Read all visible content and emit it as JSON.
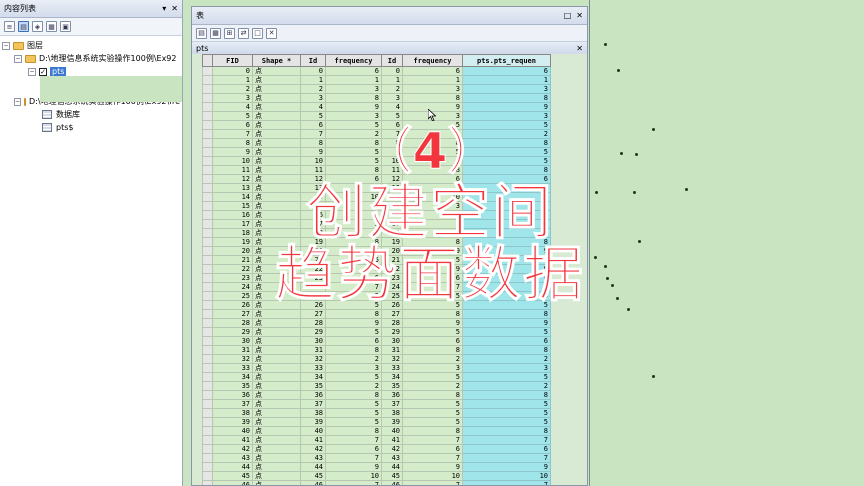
{
  "toc": {
    "title": "内容列表",
    "controls": [
      "▾",
      "✕"
    ],
    "tree": {
      "layers_root": "图层",
      "folder1": "D:\\地理信息系统实验操作100例\\Ex92",
      "layer_pts": "pts",
      "folder2": "D:\\地理信息系统实验操作100例\\Ex92\\fre",
      "table1": "数据库",
      "table2": "pts$"
    }
  },
  "table_window": {
    "title": "表",
    "controls": [
      "□",
      "✕"
    ],
    "tab_name": "pts",
    "tab_close": "✕",
    "columns": [
      "FID",
      "Shape *",
      "Id",
      "frequency",
      "Id",
      "frequency",
      "pts.pts_requen"
    ],
    "shape_value": "点",
    "rows": [
      [
        0,
        0,
        6,
        0,
        6,
        6
      ],
      [
        1,
        1,
        1,
        1,
        1,
        1
      ],
      [
        2,
        2,
        3,
        2,
        3,
        3
      ],
      [
        3,
        3,
        8,
        3,
        8,
        8
      ],
      [
        4,
        4,
        9,
        4,
        9,
        9
      ],
      [
        5,
        5,
        3,
        5,
        3,
        3
      ],
      [
        6,
        6,
        5,
        6,
        5,
        5
      ],
      [
        7,
        7,
        2,
        7,
        2,
        2
      ],
      [
        8,
        8,
        8,
        8,
        8,
        8
      ],
      [
        9,
        9,
        5,
        9,
        5,
        5
      ],
      [
        10,
        10,
        5,
        10,
        5,
        5
      ],
      [
        11,
        11,
        8,
        11,
        8,
        8
      ],
      [
        12,
        12,
        6,
        12,
        6,
        6
      ],
      [
        13,
        13,
        1,
        13,
        1,
        1
      ],
      [
        14,
        14,
        10,
        14,
        10,
        10
      ],
      [
        15,
        15,
        3,
        15,
        3,
        3
      ],
      [
        16,
        16,
        1,
        16,
        1,
        1
      ],
      [
        17,
        17,
        5,
        17,
        5,
        5
      ],
      [
        18,
        18,
        9,
        18,
        9,
        9
      ],
      [
        19,
        19,
        8,
        19,
        8,
        8
      ],
      [
        20,
        20,
        9,
        20,
        9,
        9
      ],
      [
        21,
        21,
        5,
        21,
        5,
        5
      ],
      [
        22,
        22,
        9,
        22,
        9,
        9
      ],
      [
        23,
        23,
        6,
        23,
        6,
        6
      ],
      [
        24,
        24,
        7,
        24,
        7,
        7
      ],
      [
        25,
        25,
        5,
        25,
        5,
        5
      ],
      [
        26,
        26,
        5,
        26,
        5,
        5
      ],
      [
        27,
        27,
        8,
        27,
        8,
        8
      ],
      [
        28,
        28,
        9,
        28,
        9,
        9
      ],
      [
        29,
        29,
        5,
        29,
        5,
        5
      ],
      [
        30,
        30,
        6,
        30,
        6,
        6
      ],
      [
        31,
        31,
        8,
        31,
        8,
        8
      ],
      [
        32,
        32,
        2,
        32,
        2,
        2
      ],
      [
        33,
        33,
        3,
        33,
        3,
        3
      ],
      [
        34,
        34,
        5,
        34,
        5,
        5
      ],
      [
        35,
        35,
        2,
        35,
        2,
        2
      ],
      [
        36,
        36,
        8,
        36,
        8,
        8
      ],
      [
        37,
        37,
        5,
        37,
        5,
        5
      ],
      [
        38,
        38,
        5,
        38,
        5,
        5
      ],
      [
        39,
        39,
        5,
        39,
        5,
        5
      ],
      [
        40,
        40,
        8,
        40,
        8,
        8
      ],
      [
        41,
        41,
        7,
        41,
        7,
        7
      ],
      [
        42,
        42,
        6,
        42,
        6,
        6
      ],
      [
        43,
        43,
        7,
        43,
        7,
        7
      ],
      [
        44,
        44,
        9,
        44,
        9,
        9
      ],
      [
        45,
        45,
        10,
        45,
        10,
        10
      ],
      [
        46,
        46,
        7,
        46,
        7,
        7
      ]
    ]
  },
  "caption": {
    "line1": "（4）",
    "line2": "创建空间",
    "line3": "趋势面数据"
  },
  "colors": {
    "caption": "#f3353d",
    "map_background": "#c9e4c0",
    "join_column": "#9fe5ea",
    "table_rows": "#d4ecc9"
  }
}
